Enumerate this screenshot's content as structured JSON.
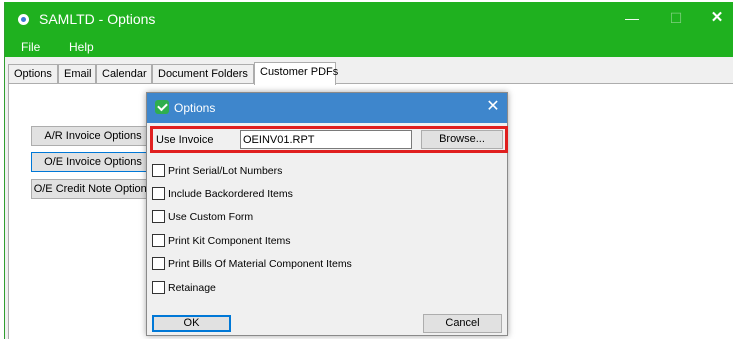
{
  "window": {
    "title": "SAMLTD - Options",
    "min_glyph": "—",
    "max_glyph": "☐",
    "close_glyph": "✕"
  },
  "menu": {
    "items": [
      {
        "label": "File"
      },
      {
        "label": "Help"
      }
    ]
  },
  "tabs": [
    {
      "label": "Options"
    },
    {
      "label": "Email"
    },
    {
      "label": "Calendar"
    },
    {
      "label": "Document Folders"
    },
    {
      "label": "Customer PDFs",
      "active": true
    }
  ],
  "panel": {
    "buttons": [
      {
        "label": "A/R Invoice Options"
      },
      {
        "label": "O/E Invoice Options"
      },
      {
        "label": "O/E Credit Note Options"
      }
    ]
  },
  "dialog": {
    "title": "Options",
    "close_glyph": "✕",
    "invoice": {
      "label": "Use Invoice",
      "value": "OEINV01.RPT",
      "browse_label": "Browse..."
    },
    "checkboxes": [
      {
        "label": "Print Serial/Lot Numbers",
        "checked": false
      },
      {
        "label": "Include Backordered Items",
        "checked": false
      },
      {
        "label": "Use Custom Form",
        "checked": false
      },
      {
        "label": "Print Kit Component Items",
        "checked": false
      },
      {
        "label": "Print Bills Of Material Component Items",
        "checked": false
      },
      {
        "label": "Retainage",
        "checked": false
      }
    ],
    "ok_label": "OK",
    "cancel_label": "Cancel"
  },
  "colors": {
    "titlebar": "#1fb11f",
    "dialog_titlebar": "#3e86cc",
    "highlight_box": "#e01f1f",
    "focus": "#0078d7"
  }
}
